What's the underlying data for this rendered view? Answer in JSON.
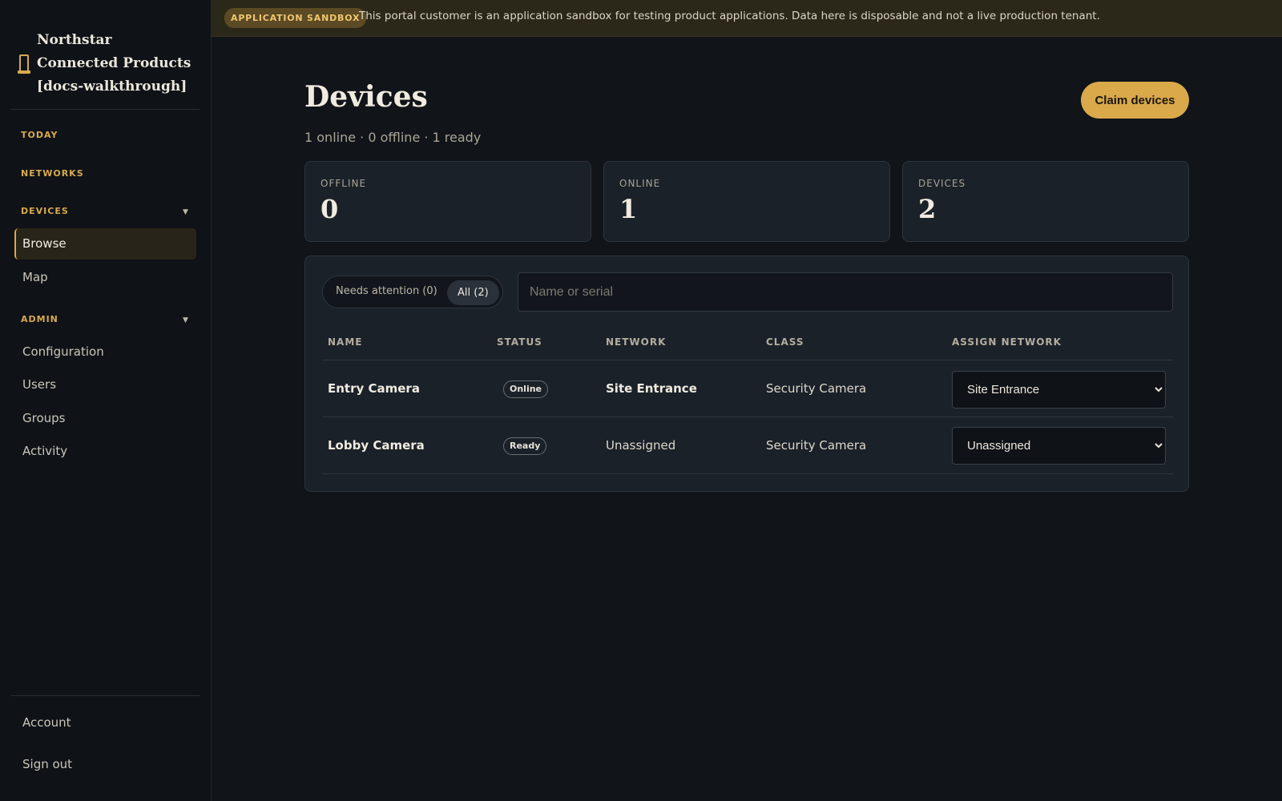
{
  "brand": {
    "name": "Northstar Connected Products [docs-walkthrough]"
  },
  "banner": {
    "badge": "APPLICATION SANDBOX",
    "text": "This portal customer is an application sandbox for testing product applications. Data here is disposable and not a live production tenant."
  },
  "sidebar": {
    "today": "TODAY",
    "networks": "NETWORKS",
    "devices": "DEVICES",
    "browse": "Browse",
    "map": "Map",
    "admin": "ADMIN",
    "configuration": "Configuration",
    "users": "Users",
    "groups": "Groups",
    "activity": "Activity",
    "account": "Account",
    "sign_out": "Sign out"
  },
  "page": {
    "title": "Devices",
    "subtitle": "1 online · 0 offline · 1 ready",
    "claim_button": "Claim devices"
  },
  "stats": {
    "offline_label": "OFFLINE",
    "offline_value": "0",
    "online_label": "ONLINE",
    "online_value": "1",
    "devices_label": "DEVICES",
    "devices_value": "2"
  },
  "filters": {
    "needs_attention": "Needs attention (0)",
    "all": "All (2)",
    "search_placeholder": "Name or serial"
  },
  "table": {
    "headers": {
      "name": "NAME",
      "status": "STATUS",
      "network": "NETWORK",
      "class": "CLASS",
      "assign": "ASSIGN NETWORK"
    },
    "rows": [
      {
        "name": "Entry Camera",
        "status": "Online",
        "network": "Site Entrance",
        "class": "Security Camera",
        "assign": "Site Entrance"
      },
      {
        "name": "Lobby Camera",
        "status": "Ready",
        "network": "Unassigned",
        "class": "Security Camera",
        "assign": "Unassigned"
      }
    ]
  },
  "colors": {
    "accent": "#d9a94a",
    "background": "#111419",
    "card": "#1b2129"
  }
}
